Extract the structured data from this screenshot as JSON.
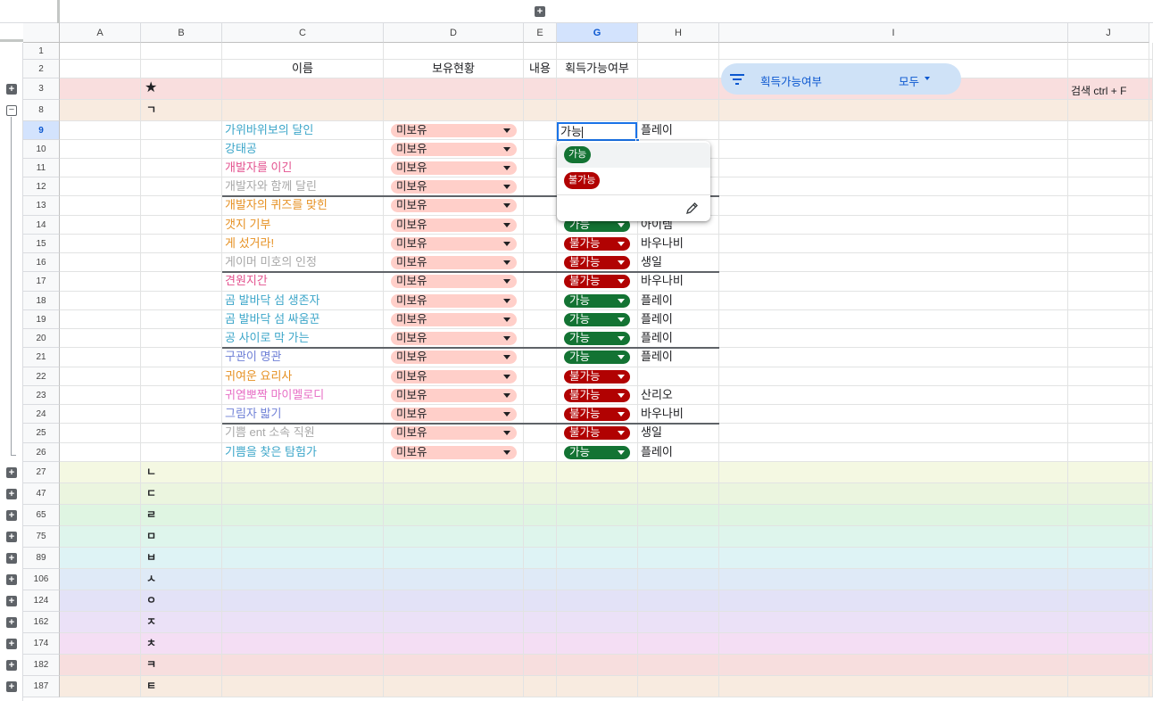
{
  "col_headers": [
    "A",
    "B",
    "C",
    "D",
    "E",
    "G",
    "H",
    "I",
    "J"
  ],
  "header_row": {
    "row": "1",
    "row2": "2",
    "name": "이름",
    "owned": "보유현황",
    "content": "내용",
    "obtainable": "획득가능여부"
  },
  "filter": {
    "label": "획득가능여부",
    "value": "모두",
    "icon": "filter-icon"
  },
  "search_hint": "검색 ctrl + F",
  "group_rows": [
    {
      "row": "3",
      "label": "★",
      "color": "#f9dede"
    },
    {
      "row": "8",
      "label": "ㄱ",
      "color": "#f8ebe0"
    }
  ],
  "entries": [
    {
      "row": "9",
      "name": "가위바위보의 달인",
      "color": "#3ca6c9",
      "owned": "미보유",
      "status": "",
      "reward": "플레이"
    },
    {
      "row": "10",
      "name": "강태공",
      "color": "#3ca6c9",
      "owned": "미보유",
      "status": "",
      "reward": ""
    },
    {
      "row": "11",
      "name": "개발자를 이긴",
      "color": "#e3518e",
      "owned": "미보유",
      "status": "",
      "reward": ""
    },
    {
      "row": "12",
      "name": "개발자와 함께 달린",
      "color": "#a8a8a8",
      "owned": "미보유",
      "status": "",
      "reward": ""
    },
    {
      "row": "13",
      "name": "개발자의 퀴즈를 맞힌",
      "color": "#e69022",
      "owned": "미보유",
      "status": "",
      "reward": ""
    },
    {
      "row": "14",
      "name": "갯지 기부",
      "color": "#e69022",
      "owned": "미보유",
      "status": "가능",
      "reward": "아이템"
    },
    {
      "row": "15",
      "name": "게 섰거라!",
      "color": "#e69022",
      "owned": "미보유",
      "status": "불가능",
      "reward": "바우나비"
    },
    {
      "row": "16",
      "name": "게이머 미호의 인정",
      "color": "#a8a8a8",
      "owned": "미보유",
      "status": "불가능",
      "reward": "생일"
    },
    {
      "row": "17",
      "name": "견원지간",
      "color": "#e3518e",
      "owned": "미보유",
      "status": "불가능",
      "reward": "바우나비"
    },
    {
      "row": "18",
      "name": "곰 발바닥 섬 생존자",
      "color": "#3ca6c9",
      "owned": "미보유",
      "status": "가능",
      "reward": "플레이"
    },
    {
      "row": "19",
      "name": "곰 발바닥 섬 싸움꾼",
      "color": "#3ca6c9",
      "owned": "미보유",
      "status": "가능",
      "reward": "플레이"
    },
    {
      "row": "20",
      "name": "공 사이로 막 가는",
      "color": "#3ca6c9",
      "owned": "미보유",
      "status": "가능",
      "reward": "플레이"
    },
    {
      "row": "21",
      "name": "구관이 명관",
      "color": "#6e7fd6",
      "owned": "미보유",
      "status": "가능",
      "reward": "플레이"
    },
    {
      "row": "22",
      "name": "귀여운 요리사",
      "color": "#e69022",
      "owned": "미보유",
      "status": "불가능",
      "reward": ""
    },
    {
      "row": "23",
      "name": "귀염뽀짝 마이멜로디",
      "color": "#e76fc5",
      "owned": "미보유",
      "status": "불가능",
      "reward": "산리오"
    },
    {
      "row": "24",
      "name": "그림자 밟기",
      "color": "#6e7fd6",
      "owned": "미보유",
      "status": "불가능",
      "reward": "바우나비"
    },
    {
      "row": "25",
      "name": "기쁨 ent 소속 직원",
      "color": "#a8a8a8",
      "owned": "미보유",
      "status": "불가능",
      "reward": "생일"
    },
    {
      "row": "26",
      "name": "기쁨을 찾은 탐험가",
      "color": "#3ca6c9",
      "owned": "미보유",
      "status": "가능",
      "reward": "플레이"
    }
  ],
  "collapsed_groups": [
    {
      "row": "27",
      "label": "ㄴ",
      "color": "#f4f8e2"
    },
    {
      "row": "47",
      "label": "ㄷ",
      "color": "#ebf5df"
    },
    {
      "row": "65",
      "label": "ㄹ",
      "color": "#dff5e2"
    },
    {
      "row": "75",
      "label": "ㅁ",
      "color": "#def5ec"
    },
    {
      "row": "89",
      "label": "ㅂ",
      "color": "#def3f5"
    },
    {
      "row": "106",
      "label": "ㅅ",
      "color": "#dfeaf7"
    },
    {
      "row": "124",
      "label": "ㅇ",
      "color": "#e3e2f7"
    },
    {
      "row": "162",
      "label": "ㅈ",
      "color": "#ebe1f7"
    },
    {
      "row": "174",
      "label": "ㅊ",
      "color": "#f4def4"
    },
    {
      "row": "182",
      "label": "ㅋ",
      "color": "#f7dede"
    },
    {
      "row": "187",
      "label": "ㅌ",
      "color": "#f8ebe0"
    }
  ],
  "editing": {
    "value": "가능"
  },
  "dropdown": {
    "options": [
      "가능",
      "불가능"
    ],
    "edit_icon": "pencil-icon"
  },
  "colors": {
    "can": "#137333",
    "cannot": "#b10202",
    "owned_chip": "#ffcfc9",
    "accent": "#1a73e8"
  }
}
